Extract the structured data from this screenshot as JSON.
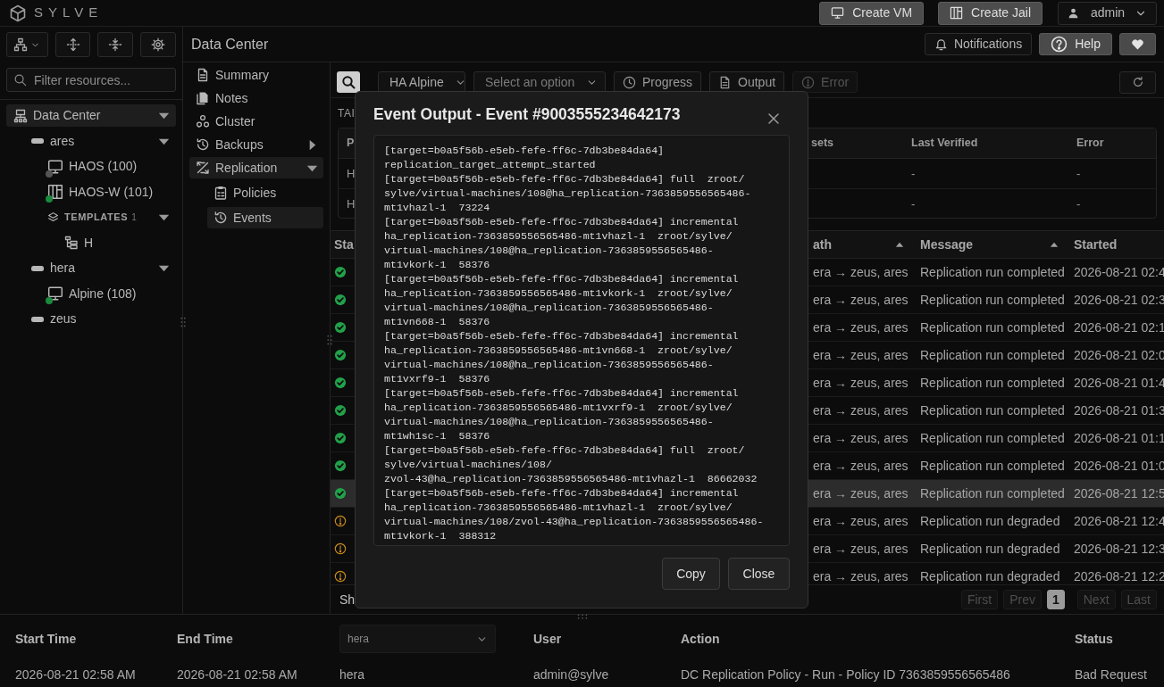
{
  "brand": "SYLVE",
  "header_buttons": [
    {
      "label": "Create VM"
    },
    {
      "label": "Create Jail"
    }
  ],
  "user_menu": {
    "label": "admin"
  },
  "sidebar": {
    "filter": {
      "placeholder": "Filter resources..."
    },
    "tree": [
      {
        "label": "Data Center",
        "kind": "datacenter",
        "selected": true,
        "expanded": true,
        "children": [
          {
            "label": "ares",
            "kind": "node",
            "selected": false,
            "expanded": true,
            "children": [
              {
                "label": "HAOS (100)",
                "kind": "vm",
                "selected": false,
                "color": "#555555"
              },
              {
                "label": "HAOS-W (101)",
                "kind": "jail",
                "selected": false,
                "color": "#1a8a3c"
              },
              {
                "label": "TEMPLATES",
                "kind": "group",
                "count": "1",
                "selected": false,
                "expanded": true,
                "children": [
                  {
                    "label": "H",
                    "kind": "template",
                    "selected": false
                  }
                ]
              }
            ]
          },
          {
            "label": "hera",
            "kind": "node",
            "selected": false,
            "expanded": true,
            "children": [
              {
                "label": "Alpine (108)",
                "kind": "vm",
                "selected": false,
                "color": "#1a8a3c"
              }
            ]
          },
          {
            "label": "zeus",
            "kind": "node",
            "selected": false
          }
        ]
      }
    ]
  },
  "page": {
    "title": "Data Center",
    "actions": [
      {
        "label": "Notifications",
        "kind": "outline"
      },
      {
        "label": "Help",
        "kind": "filled"
      },
      {
        "kind": "filled"
      }
    ]
  },
  "nav": [
    {
      "label": "Summary",
      "selected": false
    },
    {
      "label": "Notes",
      "selected": false
    },
    {
      "label": "Cluster",
      "selected": false
    },
    {
      "label": "Backups",
      "selected": false,
      "expanded": false
    },
    {
      "label": "Replication",
      "selected": true,
      "expanded": true,
      "children": [
        {
          "label": "Policies",
          "selected": false
        },
        {
          "label": "Events",
          "selected": true
        }
      ]
    }
  ],
  "toolbar": [
    {
      "kind": "search"
    },
    {
      "kind": "select",
      "value": "HA Alpine"
    },
    {
      "kind": "select",
      "placeholder": "Select an option"
    },
    {
      "kind": "button",
      "label": "Progress",
      "disabled": false
    },
    {
      "kind": "button",
      "label": "Output",
      "disabled": false
    },
    {
      "kind": "button",
      "label": "Error",
      "disabled": true
    }
  ],
  "targets": {
    "label": "TAI",
    "columns": [
      "P",
      "sets",
      "Last Verified",
      "Error"
    ],
    "rows": [
      {
        "policy": "H",
        "last_verified": "-",
        "error": "-"
      },
      {
        "policy": "H",
        "last_verified": "-",
        "error": "-"
      }
    ]
  },
  "events": {
    "columns": [
      {
        "label": "Sta",
        "sorted": false
      },
      {
        "label": "ath",
        "sorted": true
      },
      {
        "label": "Message",
        "sorted": true
      },
      {
        "label": "Started",
        "sorted": false
      }
    ],
    "rows": [
      {
        "kind": "success",
        "path": "era → zeus, ares",
        "message": "Replication run completed",
        "started": "2026-08-21 02:4",
        "selected": false
      },
      {
        "kind": "success",
        "path": "era → zeus, ares",
        "message": "Replication run completed",
        "started": "2026-08-21 02:3",
        "selected": false
      },
      {
        "kind": "success",
        "path": "era → zeus, ares",
        "message": "Replication run completed",
        "started": "2026-08-21 02:1",
        "selected": false
      },
      {
        "kind": "success",
        "path": "era → zeus, ares",
        "message": "Replication run completed",
        "started": "2026-08-21 02:0",
        "selected": false
      },
      {
        "kind": "success",
        "path": "era → zeus, ares",
        "message": "Replication run completed",
        "started": "2026-08-21 01:4",
        "selected": false
      },
      {
        "kind": "success",
        "path": "era → zeus, ares",
        "message": "Replication run completed",
        "started": "2026-08-21 01:3",
        "selected": false
      },
      {
        "kind": "success",
        "path": "era → zeus, ares",
        "message": "Replication run completed",
        "started": "2026-08-21 01:1",
        "selected": false
      },
      {
        "kind": "success",
        "path": "era → zeus, ares",
        "message": "Replication run completed",
        "started": "2026-08-21 01:0",
        "selected": false
      },
      {
        "kind": "success",
        "path": "era → zeus, ares",
        "message": "Replication run completed",
        "started": "2026-08-21 12:5",
        "selected": true
      },
      {
        "kind": "degraded",
        "path": "era → zeus, ares",
        "message": "Replication run degraded",
        "started": "2026-08-21 12:4",
        "selected": false
      },
      {
        "kind": "degraded",
        "path": "era → zeus, ares",
        "message": "Replication run degraded",
        "started": "2026-08-21 12:3",
        "selected": false
      },
      {
        "kind": "degraded",
        "path": "era → zeus, ares",
        "message": "Replication run degraded",
        "started": "2026-08-21 12:2",
        "selected": false
      }
    ],
    "summary": "Sh",
    "pages": [
      {
        "label": "First",
        "kind": "nav",
        "disabled": true,
        "selected": false
      },
      {
        "label": "Prev",
        "kind": "nav",
        "disabled": true,
        "selected": false
      },
      {
        "label": "1",
        "kind": "page",
        "disabled": false,
        "selected": true
      },
      {
        "label": "Next",
        "kind": "nav",
        "disabled": true,
        "selected": false
      },
      {
        "label": "Last",
        "kind": "nav",
        "disabled": true,
        "selected": false
      }
    ]
  },
  "audit": {
    "columns": [
      {
        "kind": "text",
        "label": "Start Time"
      },
      {
        "kind": "text",
        "label": "End Time"
      },
      {
        "kind": "filter",
        "value": "hera"
      },
      {
        "kind": "text",
        "label": "User"
      },
      {
        "kind": "text",
        "label": "Action"
      },
      {
        "kind": "text",
        "label": "Status"
      }
    ],
    "rows": [
      {
        "cells": [
          "2026-08-21 02:58 AM",
          "2026-08-21 02:58 AM",
          "hera",
          "admin@sylve",
          "DC Replication Policy - Run - Policy ID 7363859556565486",
          "Bad Request"
        ]
      }
    ]
  },
  "modal": {
    "title": "Event Output - Event #9003555234642173",
    "output_lines": [
      "[target=b0a5f56b-e5eb-fefe-ff6c-7db3be84da64]",
      "replication_target_attempt_started",
      "[target=b0a5f56b-e5eb-fefe-ff6c-7db3be84da64] full  zroot/",
      "sylve/virtual-machines/108@ha_replication-7363859556565486-",
      "mt1vhazl-1  73224",
      "[target=b0a5f56b-e5eb-fefe-ff6c-7db3be84da64] incremental",
      "ha_replication-7363859556565486-mt1vhazl-1  zroot/sylve/",
      "virtual-machines/108@ha_replication-7363859556565486-",
      "mt1vkork-1  58376",
      "[target=b0a5f56b-e5eb-fefe-ff6c-7db3be84da64] incremental",
      "ha_replication-7363859556565486-mt1vkork-1  zroot/sylve/",
      "virtual-machines/108@ha_replication-7363859556565486-",
      "mt1vn668-1  58376",
      "[target=b0a5f56b-e5eb-fefe-ff6c-7db3be84da64] incremental",
      "ha_replication-7363859556565486-mt1vn668-1  zroot/sylve/",
      "virtual-machines/108@ha_replication-7363859556565486-",
      "mt1vxrf9-1  58376",
      "[target=b0a5f56b-e5eb-fefe-ff6c-7db3be84da64] incremental",
      "ha_replication-7363859556565486-mt1vxrf9-1  zroot/sylve/",
      "virtual-machines/108@ha_replication-7363859556565486-",
      "mt1wh1sc-1  58376",
      "[target=b0a5f56b-e5eb-fefe-ff6c-7db3be84da64] full  zroot/",
      "sylve/virtual-machines/108/",
      "zvol-43@ha_replication-7363859556565486-mt1vhazl-1  86662032",
      "[target=b0a5f56b-e5eb-fefe-ff6c-7db3be84da64] incremental",
      "ha_replication-7363859556565486-mt1vhazl-1  zroot/sylve/",
      "virtual-machines/108/zvol-43@ha_replication-7363859556565486-",
      "mt1vkork-1  388312"
    ],
    "buttons": [
      {
        "label": "Copy"
      },
      {
        "label": "Close"
      }
    ]
  }
}
